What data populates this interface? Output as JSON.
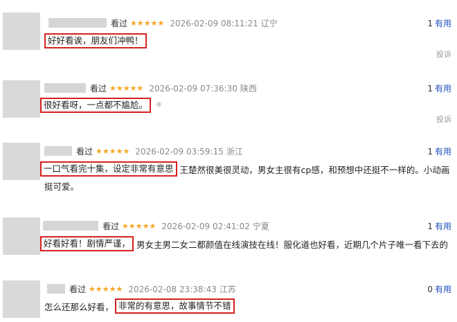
{
  "colors": {
    "accent_red": "#d61f1f",
    "star": "#f5a623",
    "link_blue": "#1f4fbf"
  },
  "icons": {
    "star": "star-icon",
    "small_mark": "flag-icon"
  },
  "reviews": [
    {
      "watched": "看过",
      "date": "2026-02-09 08:11:21",
      "location": "辽宁",
      "useful_count": "1",
      "useful_label": "有用",
      "highlight": "好好看诶，朋友们冲鸭！",
      "rest": "",
      "rest2": "",
      "report": "投诉",
      "small_mark": ""
    },
    {
      "watched": "看过",
      "date": "2026-02-09 07:36:30",
      "location": "陕西",
      "useful_count": "1",
      "useful_label": "有用",
      "highlight": "很好看呀，一点都不尴尬。",
      "rest": "",
      "rest2": "",
      "report": "投诉",
      "small_mark": "®"
    },
    {
      "watched": "看过",
      "date": "2026-02-09 03:59:15",
      "location": "浙江",
      "useful_count": "1",
      "useful_label": "有用",
      "highlight": "一口气看完十集，设定非常有意思",
      "rest": "王楚然很美很灵动，男女主很有cp感，和预想中还挺不一样的。小动画",
      "rest2": "挺可爱。",
      "report": "",
      "small_mark": ""
    },
    {
      "watched": "看过",
      "date": "2026-02-09 02:41:02",
      "location": "宁夏",
      "useful_count": "1",
      "useful_label": "有用",
      "highlight": "好看好看！剧情严谨，",
      "rest": "男女主男二女二都颜值在线演技在线！服化道也好看，近期几个片子唯一看下去的",
      "rest2": "",
      "report": "",
      "small_mark": ""
    },
    {
      "watched": "看过",
      "date": "2026-02-08 23:38:43",
      "location": "江苏",
      "useful_count": "0",
      "useful_label": "有用",
      "prefix": "怎么还那么好看，",
      "highlight": "非常的有意思，故事情节不错",
      "rest": "",
      "rest2": "",
      "report": "",
      "small_mark": ""
    }
  ]
}
